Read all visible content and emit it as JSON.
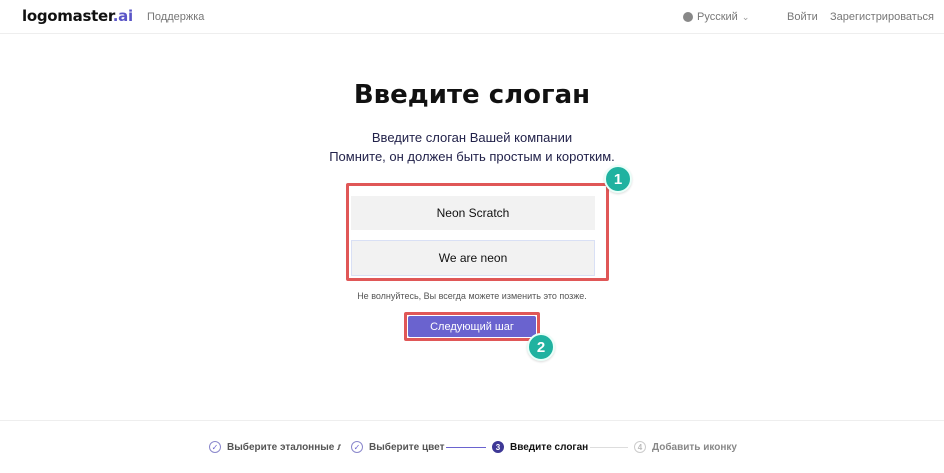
{
  "header": {
    "logo_main": "logomaster",
    "logo_suffix": ".ai",
    "support": "Поддержка",
    "language": "Русский",
    "login": "Войти",
    "signup": "Зарегистрироваться"
  },
  "main": {
    "title": "Введите слоган",
    "subtitle_line1": "Введите слоган Вашей компании",
    "subtitle_line2": "Помните, он должен быть простым и коротким.",
    "company_name": "Neon Scratch",
    "slogan": "We are neon",
    "note": "Не волнуйтесь, Вы всегда можете изменить это позже.",
    "next_button": "Следующий шаг",
    "badge1": "1",
    "badge2": "2"
  },
  "steps": [
    {
      "number": "✓",
      "label": "Выберите эталонные логотипы",
      "state": "done"
    },
    {
      "number": "✓",
      "label": "Выберите цвет",
      "state": "done"
    },
    {
      "number": "3",
      "label": "Введите слоган",
      "state": "active"
    },
    {
      "number": "4",
      "label": "Добавить иконку",
      "state": "future"
    }
  ],
  "colors": {
    "accent": "#6a63cf",
    "highlight": "#e05757",
    "badge": "#20b2a0"
  },
  "icons": {
    "language": "globe-icon",
    "dropdown": "chevron-down-icon",
    "step_done": "check-circle-icon"
  }
}
